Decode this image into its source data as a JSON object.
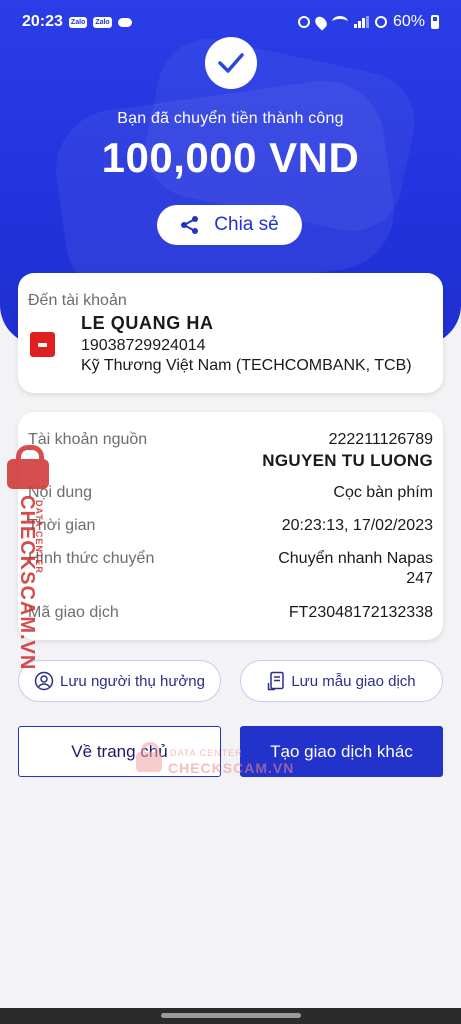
{
  "status_bar": {
    "time": "20:23",
    "apps": [
      "Zalo",
      "Zalo"
    ],
    "battery": "60%"
  },
  "hero": {
    "success_message": "Bạn đã chuyển tiền thành công",
    "amount": "100,000 VND",
    "share_label": "Chia sẻ"
  },
  "destination": {
    "label": "Đến tài khoản",
    "name": "LE QUANG HA",
    "account_number": "19038729924014",
    "bank": "Kỹ Thương Việt Nam (TECHCOMBANK, TCB)"
  },
  "details": {
    "source_label": "Tài khoản nguồn",
    "source_account": "222211126789",
    "source_name": "NGUYEN TU LUONG",
    "content_label": "Nội dung",
    "content_value": "Cọc bàn phím",
    "time_label": "Thời gian",
    "time_value": "20:23:13, 17/02/2023",
    "method_label": "Hình thức chuyển",
    "method_value_line1": "Chuyển nhanh Napas",
    "method_value_line2": "247",
    "txn_label": "Mã giao dịch",
    "txn_value": "FT23048172132338"
  },
  "actions": {
    "save_recipient": "Lưu người thụ hưởng",
    "save_template": "Lưu mẫu giao dịch",
    "home": "Về trang chủ",
    "new_transaction": "Tạo giao dịch khác"
  },
  "watermark": {
    "brand": "CHECKSCAM.VN",
    "tag": "DATA CENTER"
  },
  "colors": {
    "primary": "#2233cc",
    "hero_bg": "#2a3de6",
    "page_bg": "#f3f3f5"
  }
}
